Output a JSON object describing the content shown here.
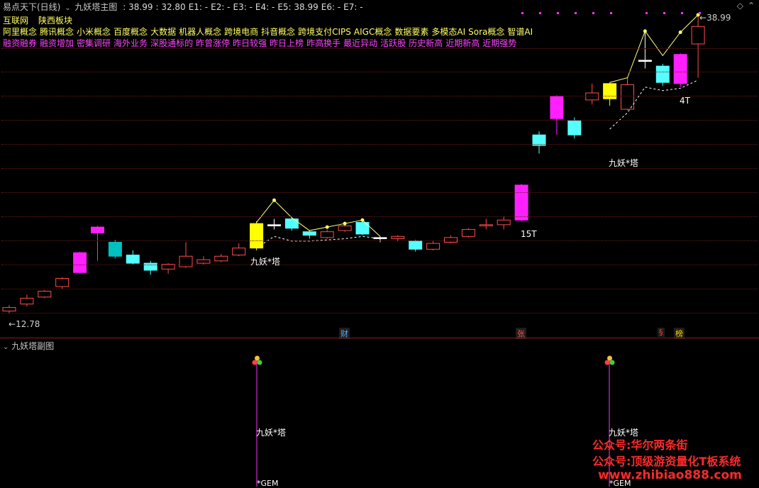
{
  "header": {
    "stock_name": "易点天下(日线)",
    "indicator_name": "九妖塔主图",
    "values": [
      {
        "label": ": 38.99",
        "color": "#dcdcdc"
      },
      {
        "label": ": 32.80",
        "color": "#dcdcdc"
      },
      {
        "label": "E1: -",
        "color": "#dcdcdc"
      },
      {
        "label": "E2: -",
        "color": "#dcdcdc"
      },
      {
        "label": "E3: -",
        "color": "#dcdcdc"
      },
      {
        "label": "E4: -",
        "color": "#dcdcdc"
      },
      {
        "label": "E5: 38.99",
        "color": "#dcdcdc"
      },
      {
        "label": "E6: -",
        "color": "#dcdcdc"
      },
      {
        "label": "E7: -",
        "color": "#dcdcdc"
      }
    ]
  },
  "concepts": {
    "row1": [
      "互联网",
      "陕西板块"
    ],
    "row2": [
      "阿里概念",
      "腾讯概念",
      "小米概念",
      "百度概念",
      "大数据",
      "机器人概念",
      "跨境电商",
      "抖音概念",
      "跨境支付CIPS",
      "AIGC概念",
      "数据要素",
      "多模态AI",
      "Sora概念",
      "智谱AI"
    ],
    "row3": [
      "融资融券",
      "融资增加",
      "密集调研",
      "海外业务",
      "深股通标的",
      "昨曾涨停",
      "昨日较强",
      "昨日上榜",
      "昨高换手",
      "最近异动",
      "活跃股",
      "历史新高",
      "近期新高",
      "近期强势"
    ],
    "row1_color": "#ffff66",
    "row2_color": "#ffff66",
    "row3_color": "#ff44ff"
  },
  "price_labels": {
    "high": "38.99",
    "low": "12.78",
    "label_15t": "15T",
    "label_4t": "4T",
    "tower1": "九妖*塔",
    "tower2": "九妖*塔"
  },
  "event_markers": [
    {
      "text": "财",
      "color": "#5fa8ff"
    },
    {
      "text": "张",
      "color": "#ff5050"
    },
    {
      "text": "§",
      "color": "#ff3333"
    },
    {
      "text": "榜",
      "color": "#ffd000"
    }
  ],
  "sub_chart": {
    "title": "九妖塔副图",
    "signal1_label": "九妖*塔",
    "signal2_label": "九妖*塔",
    "gem1_label": "*GEM",
    "gem2_label": "*GEM"
  },
  "watermark": {
    "line1": "公众号:华尔两条街",
    "line2": "公众号:顶级游资量化T板系统",
    "line3": "www.zhibiao888.com"
  },
  "chart_data": {
    "type": "candlestick",
    "y_range": [
      12.78,
      38.99
    ],
    "candles": [
      {
        "o": 13.6,
        "c": 13.9,
        "h": 14.1,
        "l": 13.4,
        "color": "red"
      },
      {
        "o": 14.2,
        "c": 14.7,
        "h": 15.0,
        "l": 14.0,
        "color": "red"
      },
      {
        "o": 14.8,
        "c": 15.3,
        "h": 15.4,
        "l": 14.7,
        "color": "red"
      },
      {
        "o": 15.7,
        "c": 16.4,
        "h": 16.5,
        "l": 15.5,
        "color": "red"
      },
      {
        "o": 16.9,
        "c": 18.6,
        "h": 18.7,
        "l": 16.8,
        "color": "magenta"
      },
      {
        "o": 20.3,
        "c": 20.8,
        "h": 20.9,
        "l": 17.9,
        "color": "magenta"
      },
      {
        "o": 19.5,
        "c": 18.3,
        "h": 19.7,
        "l": 18.1,
        "color": "teal"
      },
      {
        "o": 18.4,
        "c": 17.7,
        "h": 18.8,
        "l": 17.6,
        "color": "cyan"
      },
      {
        "o": 17.7,
        "c": 17.1,
        "h": 17.9,
        "l": 16.7,
        "color": "cyan"
      },
      {
        "o": 17.2,
        "c": 17.6,
        "h": 17.7,
        "l": 16.8,
        "color": "red"
      },
      {
        "o": 17.4,
        "c": 18.3,
        "h": 19.5,
        "l": 17.3,
        "color": "red"
      },
      {
        "o": 17.7,
        "c": 18.0,
        "h": 18.3,
        "l": 17.6,
        "color": "red"
      },
      {
        "o": 17.9,
        "c": 18.3,
        "h": 18.5,
        "l": 17.8,
        "color": "red"
      },
      {
        "o": 18.4,
        "c": 19.0,
        "h": 19.4,
        "l": 18.3,
        "color": "red"
      },
      {
        "o": 19.0,
        "c": 21.1,
        "h": 21.3,
        "l": 18.8,
        "color": "yellow"
      },
      {
        "o": 21.0,
        "c": 20.9,
        "h": 21.5,
        "l": 20.6,
        "color": "white"
      },
      {
        "o": 21.5,
        "c": 20.7,
        "h": 21.6,
        "l": 20.5,
        "color": "cyan"
      },
      {
        "o": 20.4,
        "c": 20.1,
        "h": 20.5,
        "l": 19.8,
        "color": "cyan"
      },
      {
        "o": 19.9,
        "c": 20.4,
        "h": 20.6,
        "l": 19.8,
        "color": "red"
      },
      {
        "o": 20.5,
        "c": 20.9,
        "h": 21.0,
        "l": 20.4,
        "color": "red"
      },
      {
        "o": 21.2,
        "c": 20.2,
        "h": 21.4,
        "l": 20.1,
        "color": "cyan"
      },
      {
        "o": 19.9,
        "c": 19.8,
        "h": 20.0,
        "l": 19.5,
        "color": "white"
      },
      {
        "o": 19.8,
        "c": 20.0,
        "h": 20.1,
        "l": 19.6,
        "color": "red"
      },
      {
        "o": 19.6,
        "c": 18.9,
        "h": 19.7,
        "l": 18.7,
        "color": "cyan"
      },
      {
        "o": 18.9,
        "c": 19.4,
        "h": 19.6,
        "l": 18.8,
        "color": "red"
      },
      {
        "o": 19.5,
        "c": 19.9,
        "h": 20.1,
        "l": 19.4,
        "color": "red"
      },
      {
        "o": 20.0,
        "c": 20.6,
        "h": 20.7,
        "l": 19.9,
        "color": "red"
      },
      {
        "o": 21.0,
        "c": 21.0,
        "h": 21.5,
        "l": 20.6,
        "color": "red"
      },
      {
        "o": 21.0,
        "c": 21.4,
        "h": 21.7,
        "l": 20.6,
        "color": "red"
      },
      {
        "o": 21.4,
        "c": 24.4,
        "h": 24.5,
        "l": 21.3,
        "color": "magenta"
      },
      {
        "o": 27.8,
        "c": 28.7,
        "h": 29.0,
        "l": 27.1,
        "color": "cyan"
      },
      {
        "o": 30.1,
        "c": 32.0,
        "h": 32.1,
        "l": 28.7,
        "color": "magenta"
      },
      {
        "o": 29.9,
        "c": 28.7,
        "h": 30.2,
        "l": 28.4,
        "color": "cyan"
      },
      {
        "o": 31.7,
        "c": 32.3,
        "h": 33.1,
        "l": 31.3,
        "color": "red"
      },
      {
        "o": 33.1,
        "c": 31.8,
        "h": 33.2,
        "l": 31.2,
        "color": "yellow"
      },
      {
        "o": 33.0,
        "c": 30.9,
        "h": 33.6,
        "l": 30.8,
        "color": "red"
      },
      {
        "o": 35.0,
        "c": 35.1,
        "h": 37.6,
        "l": 34.4,
        "color": "white"
      },
      {
        "o": 34.6,
        "c": 33.2,
        "h": 34.8,
        "l": 32.9,
        "color": "cyan"
      },
      {
        "o": 33.1,
        "c": 35.6,
        "h": 35.7,
        "l": 32.8,
        "color": "magenta"
      },
      {
        "o": 36.5,
        "c": 38.0,
        "h": 38.99,
        "l": 33.6,
        "color": "red"
      }
    ]
  }
}
